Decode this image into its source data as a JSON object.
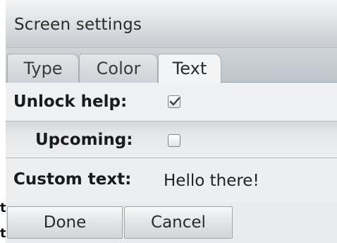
{
  "window": {
    "title": "Screen settings"
  },
  "tabs": [
    {
      "label": "Type",
      "active": false
    },
    {
      "label": "Color",
      "active": false
    },
    {
      "label": "Text",
      "active": true
    }
  ],
  "settings": {
    "unlock_help": {
      "label": "Unlock help:",
      "checked": true
    },
    "upcoming": {
      "label": "Upcoming:",
      "checked": false
    },
    "custom_text": {
      "label": "Custom text:",
      "value": "Hello there!"
    }
  },
  "buttons": {
    "done": "Done",
    "cancel": "Cancel"
  },
  "background_fragments": [
    "t",
    "t"
  ]
}
